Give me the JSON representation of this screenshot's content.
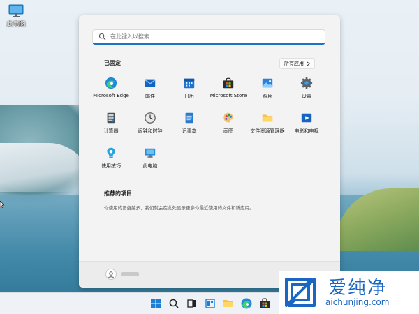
{
  "desktop": {
    "icon_label": "此电脑"
  },
  "start_menu": {
    "search_placeholder": "在此键入以搜索",
    "pinned_title": "已固定",
    "all_apps_label": "所有应用",
    "pinned_apps": [
      {
        "label": "Microsoft Edge",
        "icon": "edge-icon"
      },
      {
        "label": "邮件",
        "icon": "mail-icon"
      },
      {
        "label": "日历",
        "icon": "calendar-icon"
      },
      {
        "label": "Microsoft Store",
        "icon": "store-icon"
      },
      {
        "label": "照片",
        "icon": "photos-icon"
      },
      {
        "label": "设置",
        "icon": "settings-icon"
      },
      {
        "label": "计算器",
        "icon": "calculator-icon"
      },
      {
        "label": "闹钟和时钟",
        "icon": "clock-icon"
      },
      {
        "label": "记事本",
        "icon": "notepad-icon"
      },
      {
        "label": "画图",
        "icon": "paint-icon"
      },
      {
        "label": "文件资源管理器",
        "icon": "folder-icon"
      },
      {
        "label": "电影和电视",
        "icon": "movies-icon"
      },
      {
        "label": "使用技巧",
        "icon": "tips-icon"
      },
      {
        "label": "此电脑",
        "icon": "this-pc-icon"
      }
    ],
    "recommended_title": "推荐的项目",
    "recommended_text": "你使用的设备越多，我们就会在此处显示更多你最近使用的文件和新应用。"
  },
  "taskbar": {
    "items": [
      "windows-icon",
      "search-icon",
      "task-view-icon",
      "widgets-icon",
      "file-explorer-icon",
      "edge-icon",
      "store-icon"
    ]
  },
  "watermark": {
    "text": "爱纯净",
    "url": "aichunjing.com"
  },
  "colors": {
    "accent": "#1e72c6",
    "watermark_blue": "#1a66c2"
  }
}
